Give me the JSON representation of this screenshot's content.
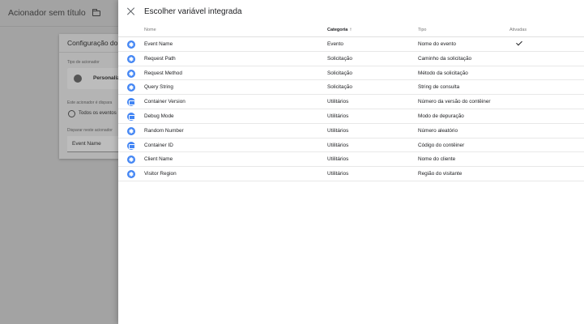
{
  "background": {
    "title": "Acionador sem título",
    "card": {
      "title": "Configuração do ac",
      "trigger_type_label": "Tipo de acionador",
      "trigger_type_value": "Personaliz",
      "fires_label": "Este acionador é dispara",
      "radio_label": "Todos os eventos",
      "fire_on_label": "Disparar neste acionador",
      "select_value": "Event Name"
    }
  },
  "panel": {
    "title": "Escolher variável integrada",
    "columns": {
      "name": "Nome",
      "category": "Categoria",
      "category_sort": "↑",
      "type": "Tipo",
      "enabled": "Ativadas"
    },
    "rows": [
      {
        "icon": "gear-icon",
        "name": "Event Name",
        "category": "Evento",
        "type": "Nome do evento",
        "enabled": true
      },
      {
        "icon": "gear-icon",
        "name": "Request Path",
        "category": "Solicitação",
        "type": "Caminho da solicitação",
        "enabled": false
      },
      {
        "icon": "gear-icon",
        "name": "Request Method",
        "category": "Solicitação",
        "type": "Método da solicitação",
        "enabled": false
      },
      {
        "icon": "gear-icon",
        "name": "Query String",
        "category": "Solicitação",
        "type": "String de consulta",
        "enabled": false
      },
      {
        "icon": "screen-icon",
        "name": "Container Version",
        "category": "Utilitários",
        "type": "Número da versão do contêiner",
        "enabled": false
      },
      {
        "icon": "screen-icon",
        "name": "Debug Mode",
        "category": "Utilitários",
        "type": "Modo de depuração",
        "enabled": false
      },
      {
        "icon": "gear-icon",
        "name": "Random Number",
        "category": "Utilitários",
        "type": "Número aleatório",
        "enabled": false
      },
      {
        "icon": "screen-icon",
        "name": "Container ID",
        "category": "Utilitários",
        "type": "Código do contêiner",
        "enabled": false
      },
      {
        "icon": "gear-icon",
        "name": "Client Name",
        "category": "Utilitários",
        "type": "Nome do cliente",
        "enabled": false
      },
      {
        "icon": "gear-icon",
        "name": "Visitor Region",
        "category": "Utilitários",
        "type": "Região do visitante",
        "enabled": false
      }
    ]
  },
  "colors": {
    "accent": "#4285f4",
    "scrim": "#a3a3a3"
  }
}
